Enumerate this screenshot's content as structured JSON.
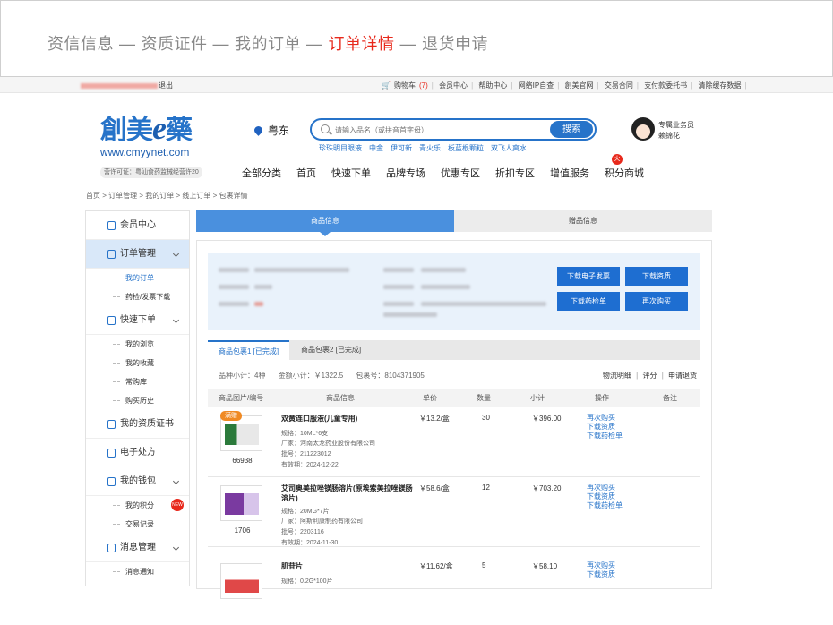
{
  "banner": {
    "step1": "资信信息",
    "step2": "资质证件",
    "step3": "我的订单",
    "step4": "订单详情",
    "step5": "退货申请",
    "sep": "—"
  },
  "topbar": {
    "logout": "退出",
    "cart": "购物车",
    "cart_count": "(7)",
    "links": [
      "会员中心",
      "帮助中心",
      "网络IP自查",
      "創美官网",
      "交易合同",
      "支付款委托书",
      "清除缓存数据"
    ]
  },
  "header": {
    "logo_cn": "創美",
    "logo_e": "e",
    "logo_cn2": "藥",
    "logo_url": "www.cmyynet.com",
    "license": "营许可证：粤汕食药监械经营许20",
    "location": "粤东",
    "search_placeholder": "请输入品名（或拼音首字母）",
    "search_button": "搜索",
    "hot_words": [
      "珍珠明目眼液",
      "中金",
      "伊可新",
      "青火乐",
      "板蓝根颗粒",
      "双飞人爽水"
    ],
    "agent_title": "专属业务员",
    "agent_name": "赖锦花",
    "nav": [
      "全部分类",
      "首页",
      "快速下单",
      "品牌专场",
      "优惠专区",
      "折扣专区",
      "增值服务",
      "积分商城"
    ],
    "fire": "火"
  },
  "breadcrumb": "首页 > 订单管理 > 我的订单 > 线上订单 > 包裹详情",
  "sidebar": {
    "member": "会员中心",
    "orders": "订单管理",
    "orders_items": [
      "我的订单",
      "药检/发票下载"
    ],
    "quick": "快速下单",
    "quick_items": [
      "我的浏览",
      "我的收藏",
      "常购库",
      "购买历史"
    ],
    "qual": "我的资质证书",
    "rx": "电子处方",
    "wallet": "我的钱包",
    "wallet_items": [
      "我的积分",
      "交易记录"
    ],
    "new_badge": "NEW",
    "msg": "消息管理",
    "msg_items": [
      "消息通知"
    ]
  },
  "tabs": {
    "goods": "商品信息",
    "gift": "赠品信息"
  },
  "buttons": {
    "invoice": "下载电子发票",
    "qual": "下载资质",
    "report": "下载药检单",
    "rebuy": "再次购买"
  },
  "packages": {
    "tab1": "商品包裹1 [已完成]",
    "tab2": "商品包裹2 [已完成]",
    "variety": "品种小计：4种",
    "amount": "金额小计：￥1322.5",
    "pkg_no": "包裹号：8104371905",
    "logistics": "物流明细",
    "rate": "评分",
    "refund": "申请退货",
    "pipe": "|"
  },
  "table": {
    "headers": [
      "商品图片/编号",
      "商品信息",
      "单价",
      "数量",
      "小计",
      "操作",
      "备注"
    ],
    "rows": [
      {
        "tag": "满赠",
        "code": "66938",
        "name": "双黄连口服液(儿童专用)",
        "spec": "规格：10ML*6支",
        "maker": "厂家：河南太龙药业股份有限公司",
        "batch": "批号：211223012",
        "expiry": "有效期：2024-12-22",
        "price": "￥13.2/盒",
        "qty": "30",
        "subtotal": "￥396.00",
        "op1": "再次购买",
        "op2": "下载资质",
        "op3": "下载药检单"
      },
      {
        "tag": "",
        "code": "1706",
        "name": "艾司奥美拉唑镁肠溶片(原埃索美拉唑镁肠溶片)",
        "spec": "规格：20MG*7片",
        "maker": "厂家：阿斯利康制药有限公司",
        "batch": "批号：2203116",
        "expiry": "有效期：2024-11-30",
        "price": "￥58.6/盒",
        "qty": "12",
        "subtotal": "￥703.20",
        "op1": "再次购买",
        "op2": "下载资质",
        "op3": "下载药检单"
      },
      {
        "tag": "",
        "code": "",
        "name": "肌苷片",
        "spec": "规格：0.2G*100片",
        "maker": "",
        "batch": "",
        "expiry": "",
        "price": "￥11.62/盒",
        "qty": "5",
        "subtotal": "￥58.10",
        "op1": "再次购买",
        "op2": "下载资质",
        "op3": ""
      }
    ]
  }
}
